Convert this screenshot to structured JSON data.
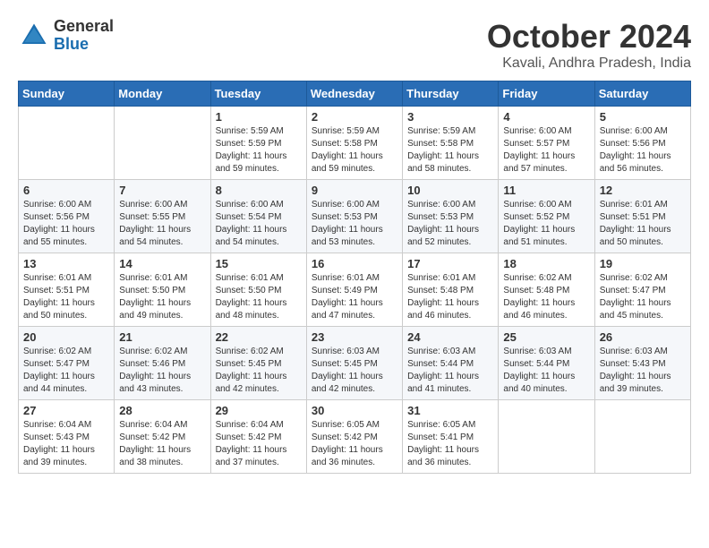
{
  "header": {
    "logo_general": "General",
    "logo_blue": "Blue",
    "month_title": "October 2024",
    "location": "Kavali, Andhra Pradesh, India"
  },
  "weekdays": [
    "Sunday",
    "Monday",
    "Tuesday",
    "Wednesday",
    "Thursday",
    "Friday",
    "Saturday"
  ],
  "weeks": [
    [
      {
        "day": "",
        "info": ""
      },
      {
        "day": "",
        "info": ""
      },
      {
        "day": "1",
        "info": "Sunrise: 5:59 AM\nSunset: 5:59 PM\nDaylight: 11 hours and 59 minutes."
      },
      {
        "day": "2",
        "info": "Sunrise: 5:59 AM\nSunset: 5:58 PM\nDaylight: 11 hours and 59 minutes."
      },
      {
        "day": "3",
        "info": "Sunrise: 5:59 AM\nSunset: 5:58 PM\nDaylight: 11 hours and 58 minutes."
      },
      {
        "day": "4",
        "info": "Sunrise: 6:00 AM\nSunset: 5:57 PM\nDaylight: 11 hours and 57 minutes."
      },
      {
        "day": "5",
        "info": "Sunrise: 6:00 AM\nSunset: 5:56 PM\nDaylight: 11 hours and 56 minutes."
      }
    ],
    [
      {
        "day": "6",
        "info": "Sunrise: 6:00 AM\nSunset: 5:56 PM\nDaylight: 11 hours and 55 minutes."
      },
      {
        "day": "7",
        "info": "Sunrise: 6:00 AM\nSunset: 5:55 PM\nDaylight: 11 hours and 54 minutes."
      },
      {
        "day": "8",
        "info": "Sunrise: 6:00 AM\nSunset: 5:54 PM\nDaylight: 11 hours and 54 minutes."
      },
      {
        "day": "9",
        "info": "Sunrise: 6:00 AM\nSunset: 5:53 PM\nDaylight: 11 hours and 53 minutes."
      },
      {
        "day": "10",
        "info": "Sunrise: 6:00 AM\nSunset: 5:53 PM\nDaylight: 11 hours and 52 minutes."
      },
      {
        "day": "11",
        "info": "Sunrise: 6:00 AM\nSunset: 5:52 PM\nDaylight: 11 hours and 51 minutes."
      },
      {
        "day": "12",
        "info": "Sunrise: 6:01 AM\nSunset: 5:51 PM\nDaylight: 11 hours and 50 minutes."
      }
    ],
    [
      {
        "day": "13",
        "info": "Sunrise: 6:01 AM\nSunset: 5:51 PM\nDaylight: 11 hours and 50 minutes."
      },
      {
        "day": "14",
        "info": "Sunrise: 6:01 AM\nSunset: 5:50 PM\nDaylight: 11 hours and 49 minutes."
      },
      {
        "day": "15",
        "info": "Sunrise: 6:01 AM\nSunset: 5:50 PM\nDaylight: 11 hours and 48 minutes."
      },
      {
        "day": "16",
        "info": "Sunrise: 6:01 AM\nSunset: 5:49 PM\nDaylight: 11 hours and 47 minutes."
      },
      {
        "day": "17",
        "info": "Sunrise: 6:01 AM\nSunset: 5:48 PM\nDaylight: 11 hours and 46 minutes."
      },
      {
        "day": "18",
        "info": "Sunrise: 6:02 AM\nSunset: 5:48 PM\nDaylight: 11 hours and 46 minutes."
      },
      {
        "day": "19",
        "info": "Sunrise: 6:02 AM\nSunset: 5:47 PM\nDaylight: 11 hours and 45 minutes."
      }
    ],
    [
      {
        "day": "20",
        "info": "Sunrise: 6:02 AM\nSunset: 5:47 PM\nDaylight: 11 hours and 44 minutes."
      },
      {
        "day": "21",
        "info": "Sunrise: 6:02 AM\nSunset: 5:46 PM\nDaylight: 11 hours and 43 minutes."
      },
      {
        "day": "22",
        "info": "Sunrise: 6:02 AM\nSunset: 5:45 PM\nDaylight: 11 hours and 42 minutes."
      },
      {
        "day": "23",
        "info": "Sunrise: 6:03 AM\nSunset: 5:45 PM\nDaylight: 11 hours and 42 minutes."
      },
      {
        "day": "24",
        "info": "Sunrise: 6:03 AM\nSunset: 5:44 PM\nDaylight: 11 hours and 41 minutes."
      },
      {
        "day": "25",
        "info": "Sunrise: 6:03 AM\nSunset: 5:44 PM\nDaylight: 11 hours and 40 minutes."
      },
      {
        "day": "26",
        "info": "Sunrise: 6:03 AM\nSunset: 5:43 PM\nDaylight: 11 hours and 39 minutes."
      }
    ],
    [
      {
        "day": "27",
        "info": "Sunrise: 6:04 AM\nSunset: 5:43 PM\nDaylight: 11 hours and 39 minutes."
      },
      {
        "day": "28",
        "info": "Sunrise: 6:04 AM\nSunset: 5:42 PM\nDaylight: 11 hours and 38 minutes."
      },
      {
        "day": "29",
        "info": "Sunrise: 6:04 AM\nSunset: 5:42 PM\nDaylight: 11 hours and 37 minutes."
      },
      {
        "day": "30",
        "info": "Sunrise: 6:05 AM\nSunset: 5:42 PM\nDaylight: 11 hours and 36 minutes."
      },
      {
        "day": "31",
        "info": "Sunrise: 6:05 AM\nSunset: 5:41 PM\nDaylight: 11 hours and 36 minutes."
      },
      {
        "day": "",
        "info": ""
      },
      {
        "day": "",
        "info": ""
      }
    ]
  ]
}
